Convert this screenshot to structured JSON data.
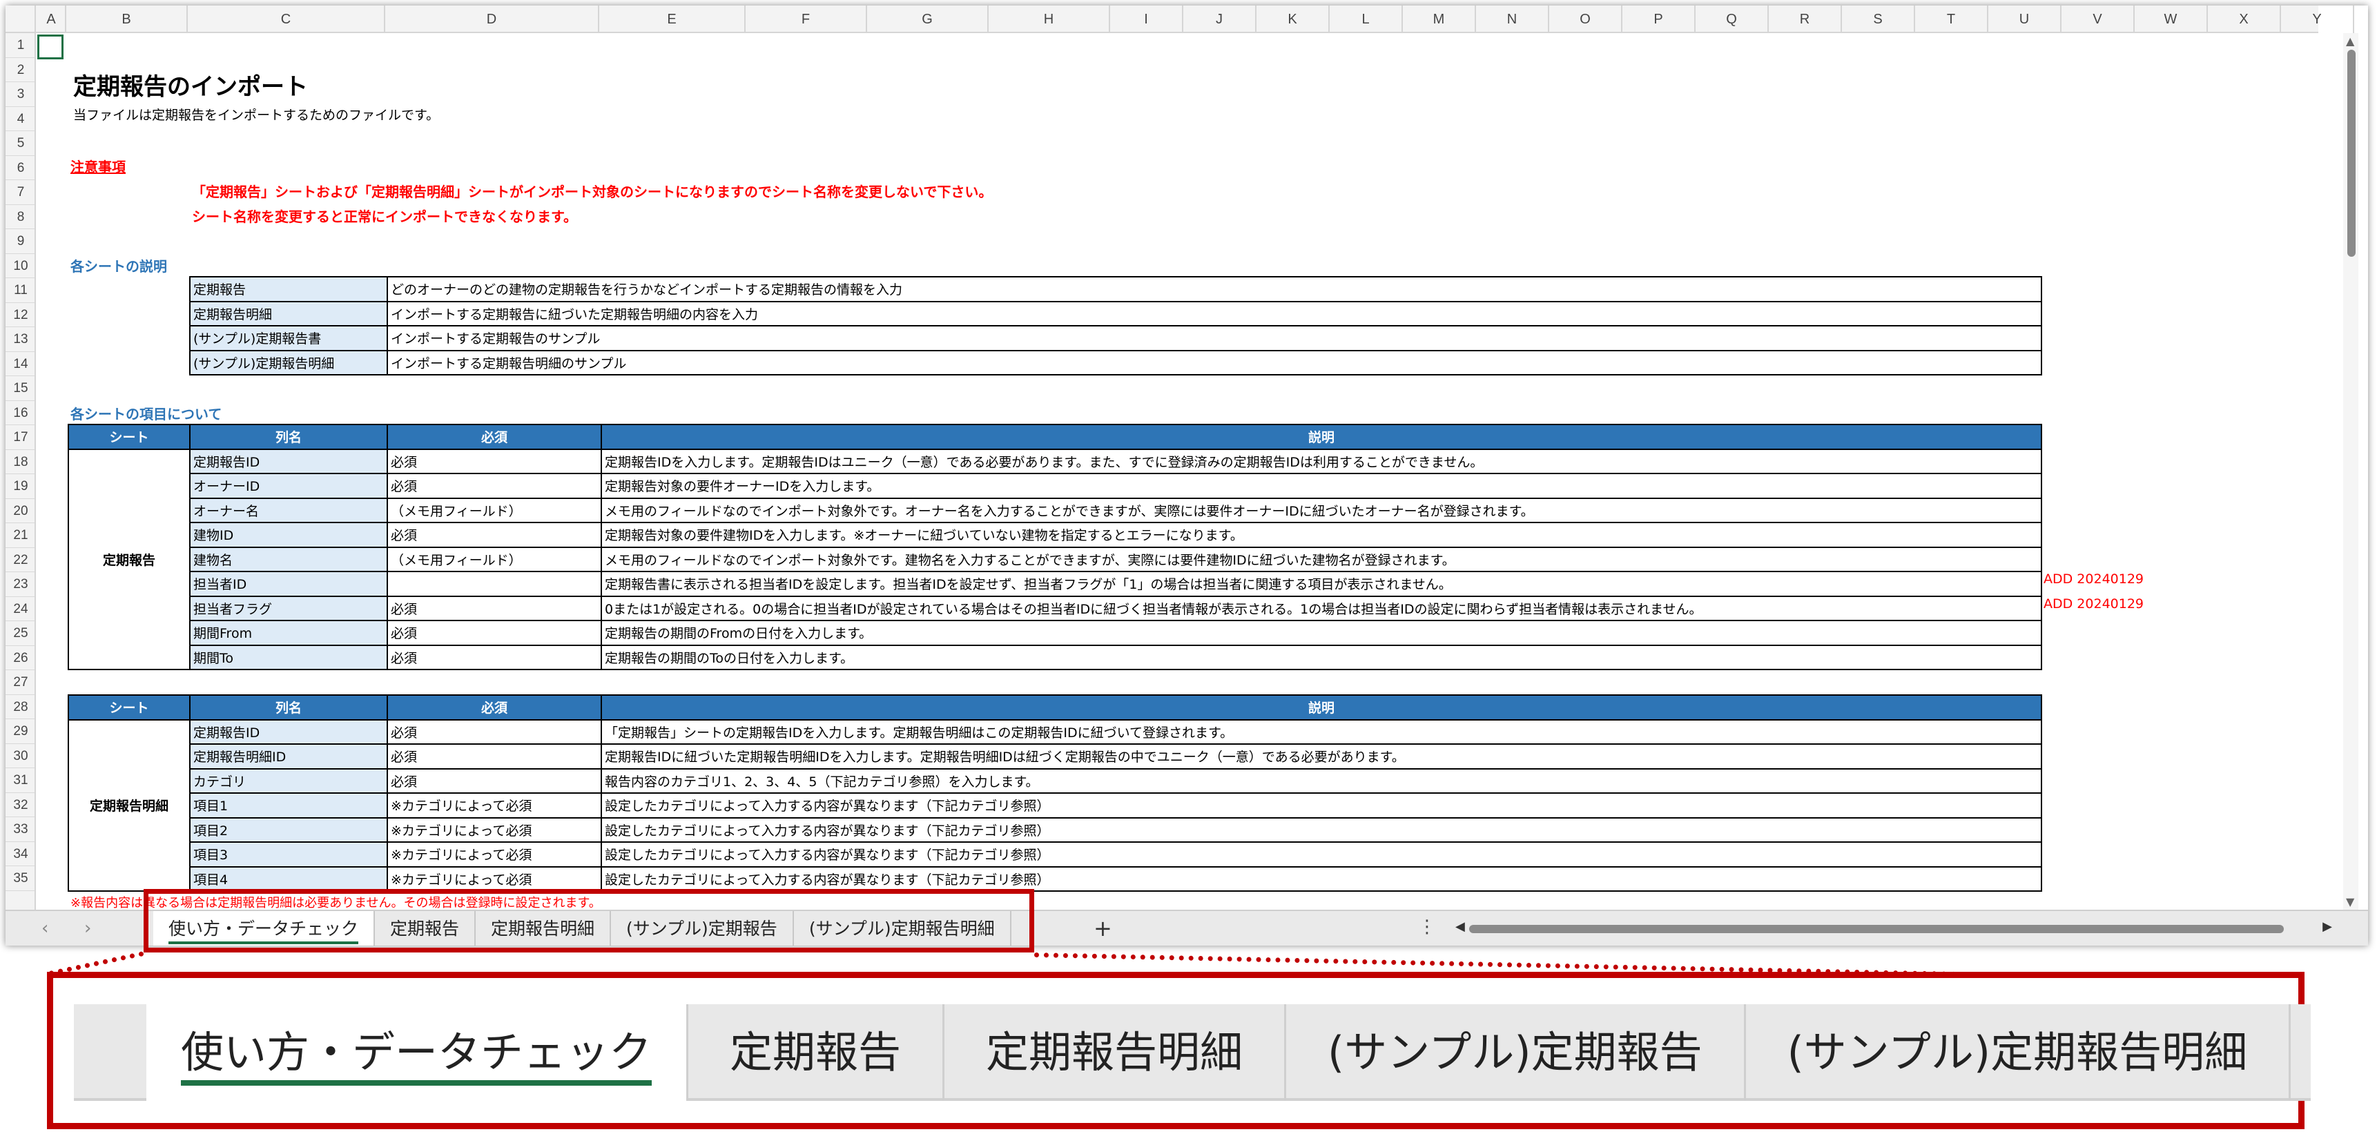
{
  "columns": [
    "A",
    "B",
    "C",
    "D",
    "E",
    "F",
    "G",
    "H",
    "I",
    "J",
    "K",
    "L",
    "M",
    "N",
    "O",
    "P",
    "Q",
    "R",
    "S",
    "T",
    "U",
    "V",
    "W",
    "X",
    "Y"
  ],
  "rows": [
    "1",
    "2",
    "3",
    "4",
    "5",
    "6",
    "7",
    "8",
    "9",
    "10",
    "11",
    "12",
    "13",
    "14",
    "15",
    "16",
    "17",
    "18",
    "19",
    "20",
    "21",
    "22",
    "23",
    "24",
    "25",
    "26",
    "27",
    "28",
    "29",
    "30",
    "31",
    "32",
    "33",
    "34",
    "35"
  ],
  "sheet": {
    "title": "定期報告のインポート",
    "subtitle": "当ファイルは定期報告をインポートするためのファイルです。",
    "notice_heading": "注意事項",
    "notice_lines": [
      "「定期報告」シートおよび「定期報告明細」シートがインポート対象のシートになりますのでシート名称を変更しないで下さい。",
      "シート名称を変更すると正常にインポートできなくなります。"
    ],
    "sheet_desc_heading": "各シートの説明",
    "sheet_desc": [
      {
        "name": "定期報告",
        "desc": "どのオーナーのどの建物の定期報告を行うかなどインポートする定期報告の情報を入力"
      },
      {
        "name": "定期報告明細",
        "desc": "インポートする定期報告に紐づいた定期報告明細の内容を入力"
      },
      {
        "name": "(サンプル)定期報告書",
        "desc": "インポートする定期報告のサンプル"
      },
      {
        "name": "(サンプル)定期報告明細",
        "desc": "インポートする定期報告明細のサンプル"
      }
    ],
    "items_heading": "各シートの項目について",
    "headers": {
      "sheet": "シート",
      "column": "列名",
      "required": "必須",
      "desc": "説明"
    },
    "table1": {
      "sheet_name": "定期報告",
      "rows": [
        {
          "col": "定期報告ID",
          "req": "必須",
          "desc": "定期報告IDを入力します。定期報告IDはユニーク（一意）である必要があります。また、すでに登録済みの定期報告IDは利用することができません。",
          "note": ""
        },
        {
          "col": "オーナーID",
          "req": "必須",
          "desc": "定期報告対象の要件オーナーIDを入力します。",
          "note": ""
        },
        {
          "col": "オーナー名",
          "req": "（メモ用フィールド）",
          "desc": "メモ用のフィールドなのでインポート対象外です。オーナー名を入力することができますが、実際には要件オーナーIDに紐づいたオーナー名が登録されます。",
          "note": ""
        },
        {
          "col": "建物ID",
          "req": "必須",
          "desc": "定期報告対象の要件建物IDを入力します。※オーナーに紐づいていない建物を指定するとエラーになります。",
          "note": ""
        },
        {
          "col": "建物名",
          "req": "（メモ用フィールド）",
          "desc": "メモ用のフィールドなのでインポート対象外です。建物名を入力することができますが、実際には要件建物IDに紐づいた建物名が登録されます。",
          "note": ""
        },
        {
          "col": "担当者ID",
          "req": "",
          "desc": "定期報告書に表示される担当者IDを設定します。担当者IDを設定せず、担当者フラグが「1」の場合は担当者に関連する項目が表示されません。",
          "note": "ADD 20240129"
        },
        {
          "col": "担当者フラグ",
          "req": "必須",
          "desc": "0または1が設定される。0の場合に担当者IDが設定されている場合はその担当者IDに紐づく担当者情報が表示される。1の場合は担当者IDの設定に関わらず担当者情報は表示されません。",
          "note": "ADD 20240129"
        },
        {
          "col": "期間From",
          "req": "必須",
          "desc": "定期報告の期間のFromの日付を入力します。",
          "note": ""
        },
        {
          "col": "期間To",
          "req": "必須",
          "desc": "定期報告の期間のToの日付を入力します。",
          "note": ""
        }
      ]
    },
    "table2": {
      "sheet_name": "定期報告明細",
      "rows": [
        {
          "col": "定期報告ID",
          "req": "必須",
          "desc": "「定期報告」シートの定期報告IDを入力します。定期報告明細はこの定期報告IDに紐づいて登録されます。"
        },
        {
          "col": "定期報告明細ID",
          "req": "必須",
          "desc": "定期報告IDに紐づいた定期報告明細IDを入力します。定期報告明細IDは紐づく定期報告の中でユニーク（一意）である必要があります。"
        },
        {
          "col": "カテゴリ",
          "req": "必須",
          "desc": "報告内容のカテゴリ1、2、3、4、5（下記カテゴリ参照）を入力します。"
        },
        {
          "col": "項目1",
          "req": "※カテゴリによって必須",
          "desc": "設定したカテゴリによって入力する内容が異なります（下記カテゴリ参照）"
        },
        {
          "col": "項目2",
          "req": "※カテゴリによって必須",
          "desc": "設定したカテゴリによって入力する内容が異なります（下記カテゴリ参照）"
        },
        {
          "col": "項目3",
          "req": "※カテゴリによって必須",
          "desc": "設定したカテゴリによって入力する内容が異なります（下記カテゴリ参照）"
        },
        {
          "col": "項目4",
          "req": "※カテゴリによって必須",
          "desc": "設定したカテゴリによって入力する内容が異なります（下記カテゴリ参照）"
        }
      ]
    },
    "row35_note": "※報告内容は異なる場合は定期報告明細は必要ありません。その場合は登録時に設定されます。"
  },
  "tabs": [
    "使い方・データチェック",
    "定期報告",
    "定期報告明細",
    "(サンプル)定期報告",
    "(サンプル)定期報告明細"
  ],
  "active_tab": "使い方・データチェック",
  "icons": {
    "prev": "chevron-left-icon",
    "next": "chevron-right-icon",
    "add": "plus-icon",
    "more": "more-vertical-icon"
  },
  "colors": {
    "header_blue": "#2e75b6",
    "label_blue": "#deebf7",
    "accent_red": "#c00000",
    "notice_red": "#ff0000",
    "heading_blue": "#2e75b6",
    "active_underline": "#1e7145"
  }
}
